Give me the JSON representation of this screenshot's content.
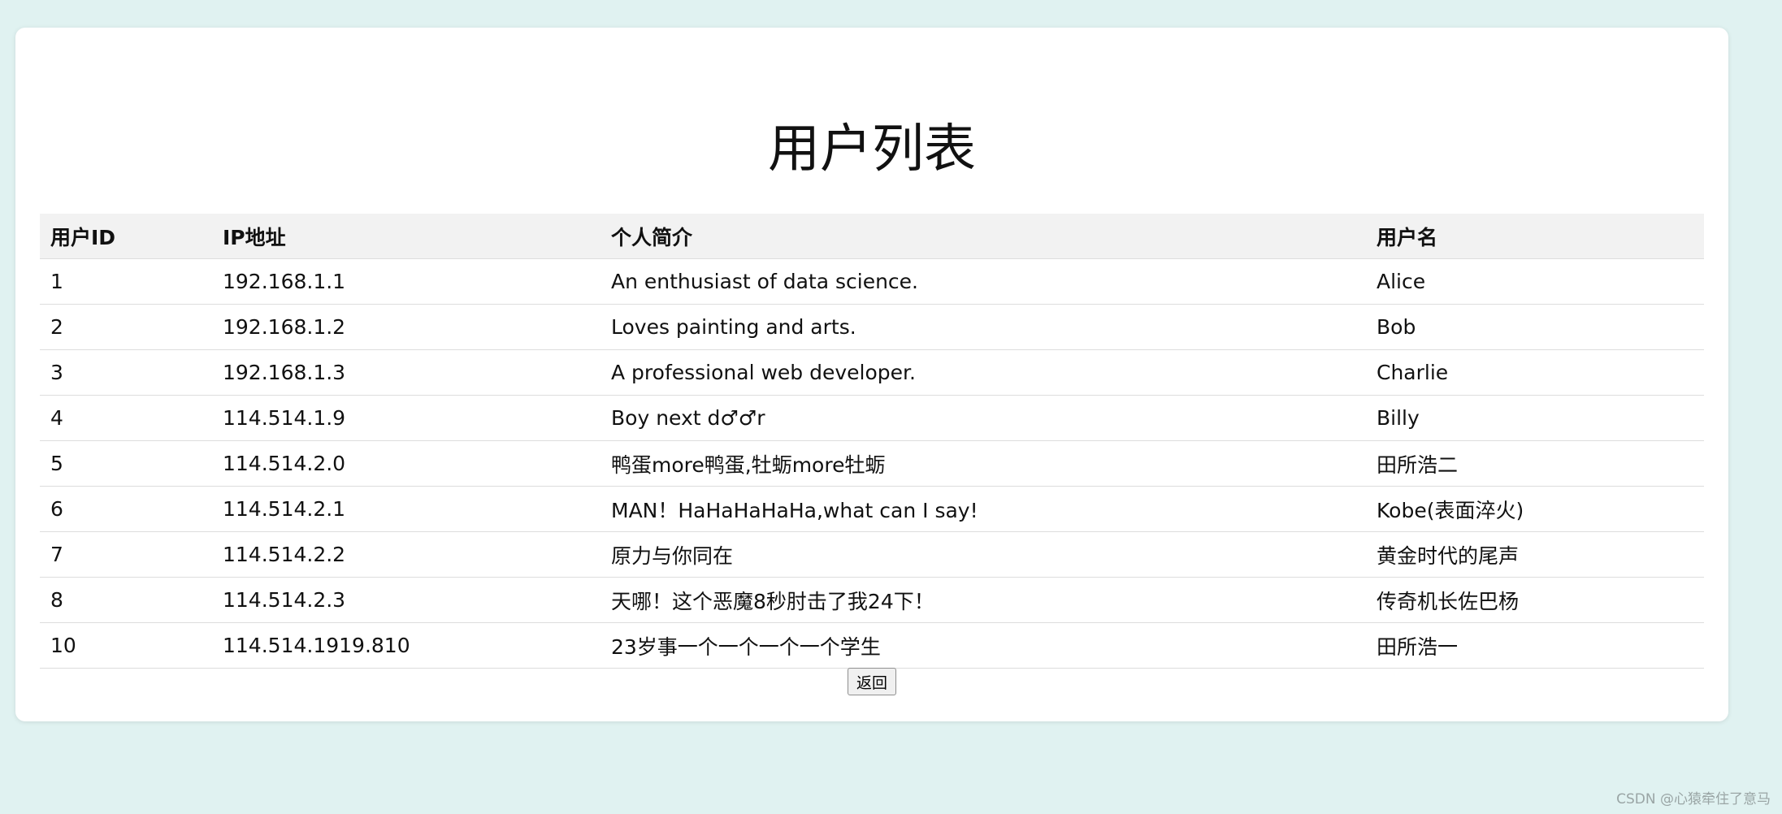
{
  "page": {
    "title": "用户列表",
    "back_label": "返回",
    "watermark": "CSDN @心猿牵住了意马"
  },
  "table": {
    "headers": [
      "用户ID",
      "IP地址",
      "个人简介",
      "用户名"
    ],
    "rows": [
      [
        "1",
        "192.168.1.1",
        "An enthusiast of data science.",
        "Alice"
      ],
      [
        "2",
        "192.168.1.2",
        "Loves painting and arts.",
        "Bob"
      ],
      [
        "3",
        "192.168.1.3",
        "A professional web developer.",
        "Charlie"
      ],
      [
        "4",
        "114.514.1.9",
        "Boy next d♂♂r",
        "Billy"
      ],
      [
        "5",
        "114.514.2.0",
        "鸭蛋more鸭蛋,牡蛎more牡蛎",
        "田所浩二"
      ],
      [
        "6",
        "114.514.2.1",
        "MAN！HaHaHaHaHa,what can I say!",
        "Kobe(表面淬火)"
      ],
      [
        "7",
        "114.514.2.2",
        "原力与你同在",
        "黄金时代的尾声"
      ],
      [
        "8",
        "114.514.2.3",
        "天哪！这个恶魔8秒肘击了我24下！",
        "传奇机长佐巴杨"
      ],
      [
        "10",
        "114.514.1919.810",
        "23岁事一个一个一个一个学生",
        "田所浩一"
      ]
    ]
  },
  "colors": {
    "background": "#e0f2f1",
    "card": "#ffffff",
    "header_row": "#f2f2f2",
    "row_border": "#dddddd"
  }
}
